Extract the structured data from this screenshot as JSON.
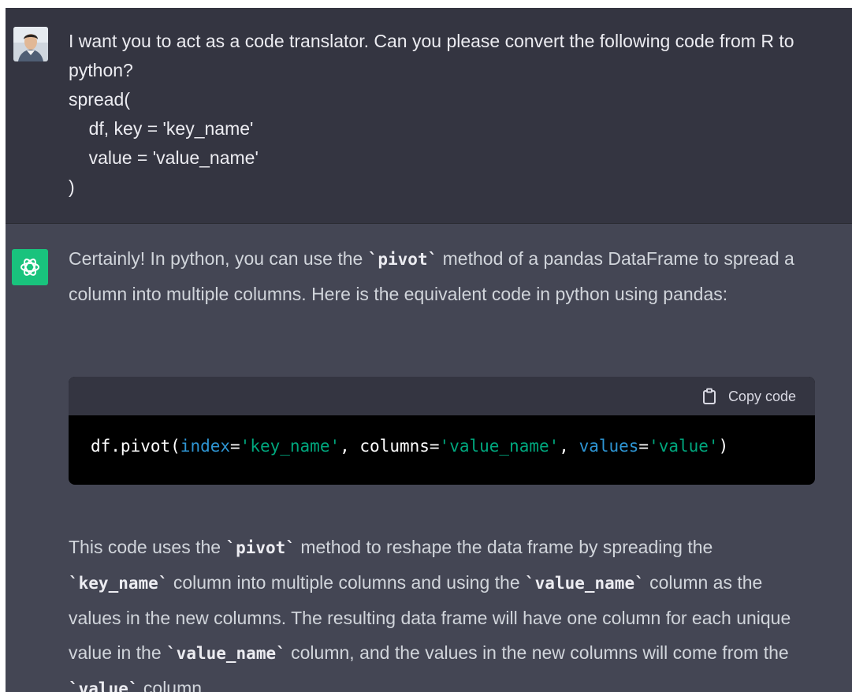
{
  "user_message": {
    "text": "I want you to act as a code translator. Can you please convert the following code from R to python?\nspread(\n    df, key = 'key_name'\n    value = 'value_name'\n)"
  },
  "assistant_message": {
    "para1": {
      "before": "Certainly! In python, you can use the ",
      "code1": "`pivot`",
      "after": " method of a pandas DataFrame to spread a column into multiple columns. Here is the equivalent code in python using pandas:"
    },
    "codeblock": {
      "copy_label": "Copy code",
      "tokens": {
        "t1": "df.pivot(",
        "t2": "index",
        "t3": "=",
        "t4": "'key_name'",
        "t5": ", columns=",
        "t6": "'value_name'",
        "t7": ", ",
        "t8": "values",
        "t9": "=",
        "t10": "'value'",
        "t11": ")"
      }
    },
    "para2": {
      "s1": "This code uses the ",
      "c1": "`pivot`",
      "s2": " method to reshape the data frame by spreading the ",
      "c2": "`key_name`",
      "s3": " column into multiple columns and using the ",
      "c3": "`value_name`",
      "s4": " column as the values in the new columns. The resulting data frame will have one column for each unique value in the ",
      "c4": "`value_name`",
      "s5": " column, and the values in the new columns will come from the ",
      "c5": "`value`",
      "s6": " column."
    }
  },
  "colors": {
    "user_bg": "#343541",
    "assistant_bg": "#444654",
    "gpt_avatar": "#19c37d",
    "code_bg": "#000000",
    "string": "#00a67d",
    "param": "#2e95d3"
  },
  "icons": {
    "user_avatar": "user-avatar",
    "gpt_logo": "openai-logo-icon",
    "copy": "clipboard-icon"
  }
}
